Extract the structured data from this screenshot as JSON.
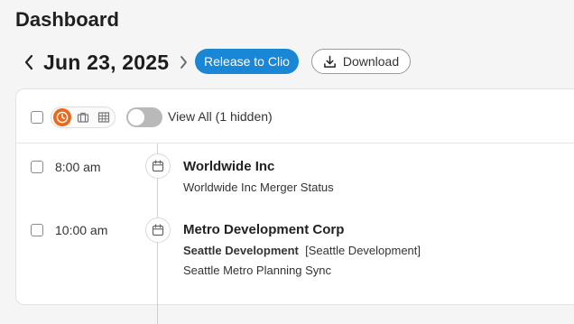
{
  "page": {
    "title": "Dashboard"
  },
  "datebar": {
    "prev_icon": "chevron-left-icon",
    "next_icon": "chevron-right-icon",
    "date": "Jun 23, 2025",
    "release_label": "Release to Clio",
    "download_label": "Download",
    "download_icon": "download-icon"
  },
  "toolbar": {
    "views": [
      "clock-icon",
      "briefcase-icon",
      "grid-icon"
    ],
    "active_view": "clock-icon",
    "toggle_on": false,
    "toggle_label": "View All (1 hidden)"
  },
  "events": [
    {
      "time": "8:00 am",
      "icon": "calendar-icon",
      "title": "Worldwide Inc",
      "matter": "",
      "matter_tag": "",
      "subtitle": "Worldwide Inc Merger Status"
    },
    {
      "time": "10:00 am",
      "icon": "calendar-icon",
      "title": "Metro Development Corp",
      "matter": "Seattle Development",
      "matter_tag": "[Seattle Development]",
      "subtitle": "Seattle Metro Planning Sync"
    }
  ],
  "colors": {
    "primary": "#1a86d6",
    "accent_orange": "#e86a1a",
    "toggle_off": "#b9b9b9"
  }
}
